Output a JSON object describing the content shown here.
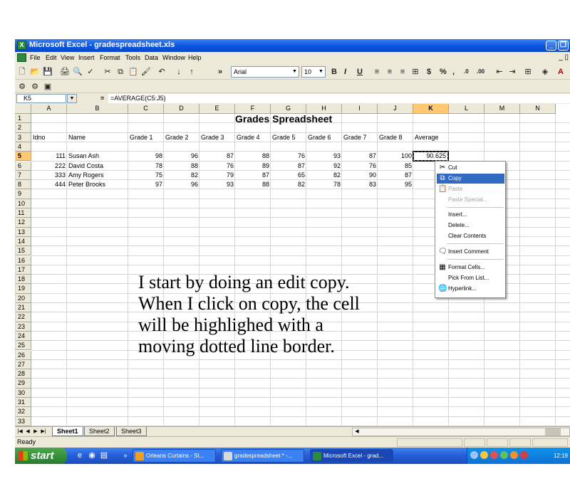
{
  "window": {
    "title": "Microsoft Excel - gradespreadsheet.xls",
    "controls": [
      "minimize",
      "restore"
    ]
  },
  "menu": [
    "File",
    "Edit",
    "View",
    "Insert",
    "Format",
    "Tools",
    "Data",
    "Window",
    "Help"
  ],
  "toolbar": {
    "font_name": "Arial",
    "font_size": "10",
    "bold": "B",
    "italic": "I",
    "underline": "U",
    "currency": "$",
    "percent": "%",
    "comma": ",",
    "inc_decimal": ".0",
    "dec_decimal": ".00",
    "overflow": "»"
  },
  "formula_bar": {
    "name_box": "K5",
    "equals": "=",
    "formula": "=AVERAGE(C5:J5)"
  },
  "columns": [
    "A",
    "B",
    "C",
    "D",
    "E",
    "F",
    "G",
    "H",
    "I",
    "J",
    "K",
    "L",
    "M",
    "N"
  ],
  "active_column": "K",
  "active_row": 5,
  "rows": [
    "1",
    "2",
    "3",
    "4",
    "5",
    "6",
    "7",
    "8",
    "9",
    "10",
    "11",
    "12",
    "13",
    "14",
    "15",
    "16",
    "17",
    "18",
    "19",
    "20",
    "21",
    "22",
    "23",
    "24",
    "25",
    "26",
    "27",
    "28",
    "29",
    "30",
    "31",
    "32",
    "33"
  ],
  "sheet": {
    "title": "Grades Spreadsheet",
    "headers": [
      "Idno",
      "Name",
      "Grade 1",
      "Grade 2",
      "Grade 3",
      "Grade 4",
      "Grade 5",
      "Grade 6",
      "Grade 7",
      "Grade 8",
      "Average"
    ],
    "records": [
      [
        "111",
        "Susan Ash",
        "98",
        "96",
        "87",
        "88",
        "76",
        "93",
        "87",
        "100",
        "90.625"
      ],
      [
        "222",
        "David Costa",
        "78",
        "88",
        "76",
        "89",
        "87",
        "92",
        "76",
        "85",
        ""
      ],
      [
        "333",
        "Amy Rogers",
        "75",
        "82",
        "79",
        "87",
        "65",
        "82",
        "90",
        "87",
        ""
      ],
      [
        "444",
        "Peter Brooks",
        "97",
        "96",
        "93",
        "88",
        "82",
        "78",
        "83",
        "95",
        ""
      ]
    ]
  },
  "context_menu": [
    {
      "label": "Cut",
      "icon": "scissors-icon",
      "state": "normal"
    },
    {
      "label": "Copy",
      "icon": "copy-icon",
      "state": "highlighted"
    },
    {
      "label": "Paste",
      "icon": "paste-icon",
      "state": "disabled"
    },
    {
      "label": "Paste Special...",
      "icon": "",
      "state": "disabled"
    },
    {
      "label": "Insert...",
      "icon": "",
      "state": "normal"
    },
    {
      "label": "Delete...",
      "icon": "",
      "state": "normal"
    },
    {
      "label": "Clear Contents",
      "icon": "",
      "state": "normal"
    },
    {
      "label": "Insert Comment",
      "icon": "comment-icon",
      "state": "normal"
    },
    {
      "label": "Format Cells...",
      "icon": "format-cells-icon",
      "state": "normal"
    },
    {
      "label": "Pick From List...",
      "icon": "",
      "state": "normal"
    },
    {
      "label": "Hyperlink...",
      "icon": "hyperlink-icon",
      "state": "normal"
    }
  ],
  "narration": [
    "I start by doing an edit copy.",
    "When I click on copy, the cell",
    "will be highlighed with a",
    "moving dotted line border."
  ],
  "sheet_tabs": [
    "Sheet1",
    "Sheet2",
    "Sheet3"
  ],
  "active_sheet": "Sheet1",
  "status": "Ready",
  "taskbar": {
    "start_label": "start",
    "tasks": [
      "Orleans Curtains - St...",
      "gradespreadsheet * -...",
      "Microsoft Excel - grad..."
    ],
    "active_task": "Microsoft Excel - grad...",
    "clock": "12:19"
  },
  "colors": {
    "title_bar": "#0a55e0",
    "menu_highlight": "#316ac5",
    "taskbar": "#245dd7",
    "start_button": "#33913a",
    "active_header": "#ffc871"
  }
}
